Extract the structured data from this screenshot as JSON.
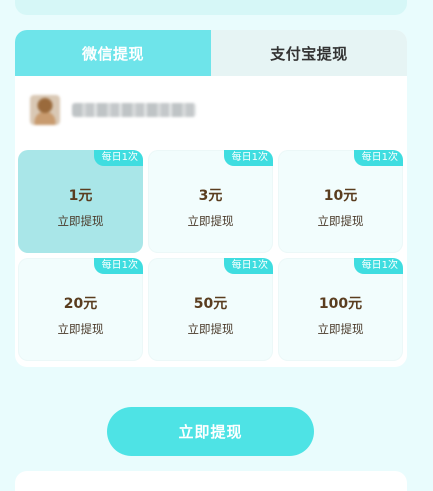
{
  "tabs": [
    {
      "label": "微信提现",
      "active": true
    },
    {
      "label": "支付宝提现",
      "active": false
    }
  ],
  "options": [
    {
      "amount": "1元",
      "action": "立即提现",
      "badge": "每日1次",
      "selected": true
    },
    {
      "amount": "3元",
      "action": "立即提现",
      "badge": "每日1次",
      "selected": false
    },
    {
      "amount": "10元",
      "action": "立即提现",
      "badge": "每日1次",
      "selected": false
    },
    {
      "amount": "20元",
      "action": "立即提现",
      "badge": "每日1次",
      "selected": false
    },
    {
      "amount": "50元",
      "action": "立即提现",
      "badge": "每日1次",
      "selected": false
    },
    {
      "amount": "100元",
      "action": "立即提现",
      "badge": "每日1次",
      "selected": false
    }
  ],
  "withdraw_button": {
    "label": "立即提现"
  },
  "colors": {
    "accent": "#4ee3e5",
    "tab_active": "#6ee4ea",
    "selected_option": "#a9e6e8",
    "background": "#e9fcfd"
  }
}
